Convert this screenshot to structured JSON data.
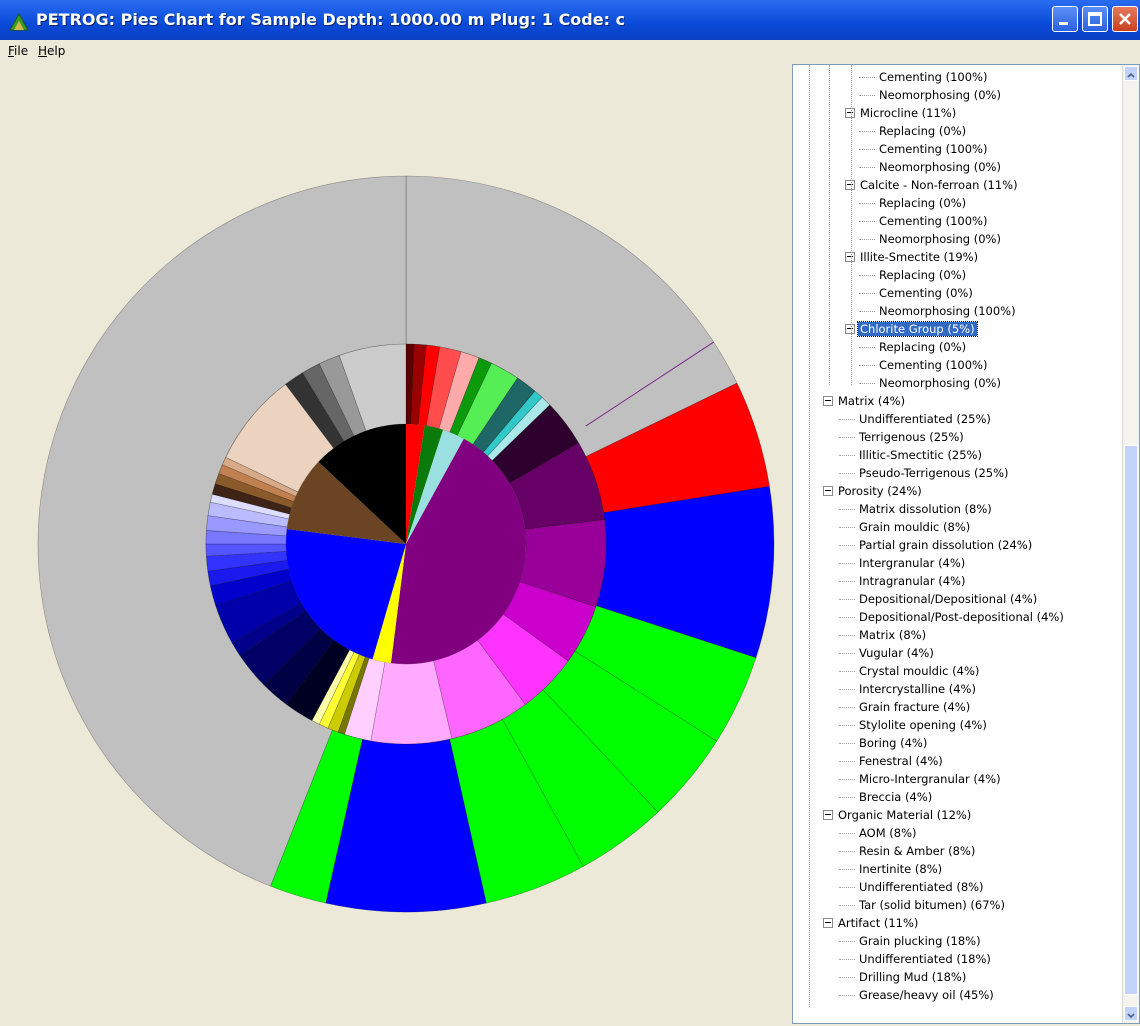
{
  "window": {
    "title": "PETROG: Pies Chart for Sample Depth:  1000.00 m   Plug: 1  Code: c"
  },
  "menu": [
    {
      "label": "File",
      "mnemonic": "F",
      "rest": "ile"
    },
    {
      "label": "Help",
      "mnemonic": "H",
      "rest": "elp"
    }
  ],
  "tree": [
    {
      "label": "Cementing (100%)",
      "level": 3,
      "expanded": null
    },
    {
      "label": "Neomorphosing (0%)",
      "level": 3,
      "expanded": null
    },
    {
      "label": "Microcline (11%)",
      "level": 2,
      "expanded": true
    },
    {
      "label": "Replacing (0%)",
      "level": 3,
      "expanded": null
    },
    {
      "label": "Cementing (100%)",
      "level": 3,
      "expanded": null
    },
    {
      "label": "Neomorphosing (0%)",
      "level": 3,
      "expanded": null
    },
    {
      "label": "Calcite - Non-ferroan (11%)",
      "level": 2,
      "expanded": true
    },
    {
      "label": "Replacing (0%)",
      "level": 3,
      "expanded": null
    },
    {
      "label": "Cementing (100%)",
      "level": 3,
      "expanded": null
    },
    {
      "label": "Neomorphosing (0%)",
      "level": 3,
      "expanded": null
    },
    {
      "label": "Illite-Smectite (19%)",
      "level": 2,
      "expanded": true
    },
    {
      "label": "Replacing (0%)",
      "level": 3,
      "expanded": null
    },
    {
      "label": "Cementing (0%)",
      "level": 3,
      "expanded": null
    },
    {
      "label": "Neomorphosing (100%)",
      "level": 3,
      "expanded": null
    },
    {
      "label": "Chlorite Group (5%)",
      "level": 2,
      "expanded": true,
      "selected": true
    },
    {
      "label": "Replacing (0%)",
      "level": 3,
      "expanded": null
    },
    {
      "label": "Cementing (100%)",
      "level": 3,
      "expanded": null
    },
    {
      "label": "Neomorphosing (0%)",
      "level": 3,
      "expanded": null
    },
    {
      "label": "Matrix (4%)",
      "level": 1,
      "expanded": true
    },
    {
      "label": "Undifferentiated (25%)",
      "level": 2,
      "expanded": null
    },
    {
      "label": "Terrigenous (25%)",
      "level": 2,
      "expanded": null
    },
    {
      "label": "Illitic-Smectitic (25%)",
      "level": 2,
      "expanded": null
    },
    {
      "label": "Pseudo-Terrigenous (25%)",
      "level": 2,
      "expanded": null
    },
    {
      "label": "Porosity (24%)",
      "level": 1,
      "expanded": true
    },
    {
      "label": "Matrix dissolution (8%)",
      "level": 2,
      "expanded": null
    },
    {
      "label": "Grain mouldic (8%)",
      "level": 2,
      "expanded": null
    },
    {
      "label": "Partial grain dissolution (24%)",
      "level": 2,
      "expanded": null
    },
    {
      "label": "Intergranular (4%)",
      "level": 2,
      "expanded": null
    },
    {
      "label": "Intragranular (4%)",
      "level": 2,
      "expanded": null
    },
    {
      "label": "Depositional/Depositional (4%)",
      "level": 2,
      "expanded": null
    },
    {
      "label": "Depositional/Post-depositional (4%)",
      "level": 2,
      "expanded": null
    },
    {
      "label": "Matrix (8%)",
      "level": 2,
      "expanded": null
    },
    {
      "label": "Vugular (4%)",
      "level": 2,
      "expanded": null
    },
    {
      "label": "Crystal mouldic (4%)",
      "level": 2,
      "expanded": null
    },
    {
      "label": "Intercrystalline (4%)",
      "level": 2,
      "expanded": null
    },
    {
      "label": "Grain fracture (4%)",
      "level": 2,
      "expanded": null
    },
    {
      "label": "Stylolite opening (4%)",
      "level": 2,
      "expanded": null
    },
    {
      "label": "Boring (4%)",
      "level": 2,
      "expanded": null
    },
    {
      "label": "Fenestral (4%)",
      "level": 2,
      "expanded": null
    },
    {
      "label": "Micro-Intergranular (4%)",
      "level": 2,
      "expanded": null
    },
    {
      "label": "Breccia (4%)",
      "level": 2,
      "expanded": null
    },
    {
      "label": "Organic Material (12%)",
      "level": 1,
      "expanded": true
    },
    {
      "label": "AOM (8%)",
      "level": 2,
      "expanded": null
    },
    {
      "label": "Resin & Amber (8%)",
      "level": 2,
      "expanded": null
    },
    {
      "label": "Inertinite (8%)",
      "level": 2,
      "expanded": null
    },
    {
      "label": "Undifferentiated (8%)",
      "level": 2,
      "expanded": null
    },
    {
      "label": "Tar (solid bitumen) (67%)",
      "level": 2,
      "expanded": null
    },
    {
      "label": "Artifact (11%)",
      "level": 1,
      "expanded": true
    },
    {
      "label": "Grain plucking (18%)",
      "level": 2,
      "expanded": null
    },
    {
      "label": "Undifferentiated (18%)",
      "level": 2,
      "expanded": null
    },
    {
      "label": "Drilling Mud (18%)",
      "level": 2,
      "expanded": null
    },
    {
      "label": "Grease/heavy oil (45%)",
      "level": 2,
      "expanded": null
    }
  ],
  "chart_data": {
    "type": "sunburst",
    "rings": [
      {
        "ring": "inner",
        "segments": [
          {
            "color": "#ff0000",
            "value": 2.5
          },
          {
            "color": "#0a7a0a",
            "value": 2.5
          },
          {
            "color": "#9ae0e0",
            "value": 3.0
          },
          {
            "color": "#800080",
            "value": 44.0
          },
          {
            "color": "#ffff00",
            "value": 2.5
          },
          {
            "color": "#0000ff",
            "value": 22.5
          },
          {
            "color": "#6b4423",
            "value": 10.0
          },
          {
            "color": "#000000",
            "value": 13.0
          }
        ]
      },
      {
        "ring": "middle",
        "segments": [
          {
            "color": "#5a0000",
            "value": 0.6
          },
          {
            "color": "#990000",
            "value": 0.9
          },
          {
            "color": "#ff0000",
            "value": 1.0
          },
          {
            "color": "#ff4d4d",
            "value": 1.6
          },
          {
            "color": "#ffaaaa",
            "value": 1.4
          },
          {
            "color": "#0a9a0a",
            "value": 1.0
          },
          {
            "color": "#55ee55",
            "value": 2.2
          },
          {
            "color": "#1f6666",
            "value": 1.6
          },
          {
            "color": "#30c8c8",
            "value": 0.7
          },
          {
            "color": "#a8e8e8",
            "value": 0.8
          },
          {
            "color": "#2d002d",
            "value": 3.5
          },
          {
            "color": "#660066",
            "value": 6.0
          },
          {
            "color": "#990099",
            "value": 6.5
          },
          {
            "color": "#cc00cc",
            "value": 4.5
          },
          {
            "color": "#ff33ff",
            "value": 4.5
          },
          {
            "color": "#ff66ff",
            "value": 6.0
          },
          {
            "color": "#ffaaff",
            "value": 6.0
          },
          {
            "color": "#ffd0ff",
            "value": 2.0
          },
          {
            "color": "#777700",
            "value": 0.5
          },
          {
            "color": "#cccc00",
            "value": 0.8
          },
          {
            "color": "#ffff33",
            "value": 0.7
          },
          {
            "color": "#ffffaa",
            "value": 0.6
          },
          {
            "color": "#000022",
            "value": 2.2
          },
          {
            "color": "#000044",
            "value": 2.2
          },
          {
            "color": "#000066",
            "value": 2.8
          },
          {
            "color": "#00008a",
            "value": 1.1
          },
          {
            "color": "#0000aa",
            "value": 3.0
          },
          {
            "color": "#0000cc",
            "value": 1.5
          },
          {
            "color": "#1a1aee",
            "value": 1.1
          },
          {
            "color": "#3333ff",
            "value": 1.1
          },
          {
            "color": "#5555ff",
            "value": 0.9
          },
          {
            "color": "#7777ff",
            "value": 1.0
          },
          {
            "color": "#9999ff",
            "value": 1.1
          },
          {
            "color": "#bbbbff",
            "value": 1.0
          },
          {
            "color": "#ddddff",
            "value": 0.6
          },
          {
            "color": "#3d2416",
            "value": 0.8
          },
          {
            "color": "#8b5a2b",
            "value": 0.8
          },
          {
            "color": "#c08050",
            "value": 0.7
          },
          {
            "color": "#d8aa88",
            "value": 0.6
          },
          {
            "color": "#ecd3c0",
            "value": 7.0
          },
          {
            "color": "#333333",
            "value": 1.5
          },
          {
            "color": "#666666",
            "value": 1.4
          },
          {
            "color": "#999999",
            "value": 1.6
          },
          {
            "color": "#cccccc",
            "value": 5.0
          }
        ]
      },
      {
        "ring": "outer",
        "segments": [
          {
            "color": "#c0c0c0",
            "value": 17.8
          },
          {
            "color": "#ff0000",
            "value": 4.7
          },
          {
            "color": "#0000ff",
            "value": 7.5
          },
          {
            "color": "#00ff00",
            "value": 4.0
          },
          {
            "color": "#00ff00",
            "value": 4.0
          },
          {
            "color": "#00ff00",
            "value": 4.0
          },
          {
            "color": "#00ff00",
            "value": 4.5
          },
          {
            "color": "#0000ff",
            "value": 7.0
          },
          {
            "color": "#00ff00",
            "value": 2.5
          },
          {
            "color": "#c0c0c0",
            "value": 44.0
          }
        ]
      }
    ]
  }
}
